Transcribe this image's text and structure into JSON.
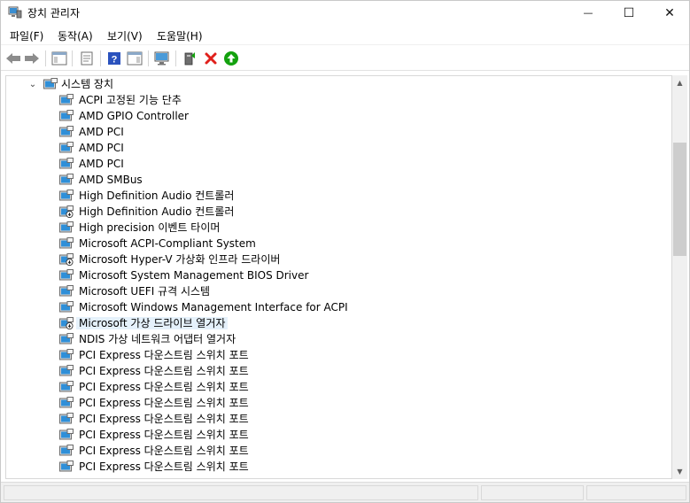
{
  "window": {
    "title": "장치 관리자",
    "minimize_symbol": "—",
    "maximize_symbol": "☐",
    "close_symbol": "✕"
  },
  "menu": {
    "items": [
      {
        "label": "파일(F)"
      },
      {
        "label": "동작(A)"
      },
      {
        "label": "보기(V)"
      },
      {
        "label": "도움말(H)"
      }
    ]
  },
  "toolbar": {
    "icons": [
      "back-arrow-icon",
      "forward-arrow-icon",
      "show-hide-console-tree-icon",
      "properties-icon",
      "help-icon",
      "action-pane-icon",
      "scan-hardware-icon",
      "update-driver-icon",
      "uninstall-device-icon",
      "enable-device-icon"
    ],
    "colors": {
      "uninstall": "#e0201b",
      "enable": "#13a10e",
      "help": "#2a52be"
    }
  },
  "tree": {
    "category": {
      "label": "시스템 장치",
      "expander": "⌄"
    },
    "items": [
      {
        "label": "ACPI 고정된 기능 단추",
        "icon": "system-device-icon"
      },
      {
        "label": "AMD GPIO Controller",
        "icon": "system-device-icon"
      },
      {
        "label": "AMD PCI",
        "icon": "system-device-icon"
      },
      {
        "label": "AMD PCI",
        "icon": "system-device-icon"
      },
      {
        "label": "AMD PCI",
        "icon": "system-device-icon"
      },
      {
        "label": "AMD SMBus",
        "icon": "system-device-icon"
      },
      {
        "label": "High Definition Audio 컨트롤러",
        "icon": "system-device-icon"
      },
      {
        "label": "High Definition Audio 컨트롤러",
        "icon": "system-device-disabled-icon"
      },
      {
        "label": "High precision 이벤트 타이머",
        "icon": "system-device-icon"
      },
      {
        "label": "Microsoft ACPI-Compliant System",
        "icon": "system-device-icon"
      },
      {
        "label": "Microsoft Hyper-V 가상화 인프라 드라이버",
        "icon": "system-device-disabled-icon"
      },
      {
        "label": "Microsoft System Management BIOS Driver",
        "icon": "system-device-icon"
      },
      {
        "label": "Microsoft UEFI 규격 시스템",
        "icon": "system-device-icon"
      },
      {
        "label": "Microsoft Windows Management Interface for ACPI",
        "icon": "system-device-icon"
      },
      {
        "label": "Microsoft 가상 드라이브 열거자",
        "icon": "system-device-disabled-icon",
        "selected": true
      },
      {
        "label": "NDIS 가상 네트워크 어댑터 열거자",
        "icon": "system-device-icon"
      },
      {
        "label": "PCI Express 다운스트림 스위치 포트",
        "icon": "system-device-icon"
      },
      {
        "label": "PCI Express 다운스트림 스위치 포트",
        "icon": "system-device-icon"
      },
      {
        "label": "PCI Express 다운스트림 스위치 포트",
        "icon": "system-device-icon"
      },
      {
        "label": "PCI Express 다운스트림 스위치 포트",
        "icon": "system-device-icon"
      },
      {
        "label": "PCI Express 다운스트림 스위치 포트",
        "icon": "system-device-icon"
      },
      {
        "label": "PCI Express 다운스트림 스위치 포트",
        "icon": "system-device-icon"
      },
      {
        "label": "PCI Express 다운스트림 스위치 포트",
        "icon": "system-device-icon"
      },
      {
        "label": "PCI Express 다운스트림 스위치 포트",
        "icon": "system-device-icon"
      }
    ]
  },
  "scrollbar": {
    "up_symbol": "▲",
    "down_symbol": "▼"
  }
}
